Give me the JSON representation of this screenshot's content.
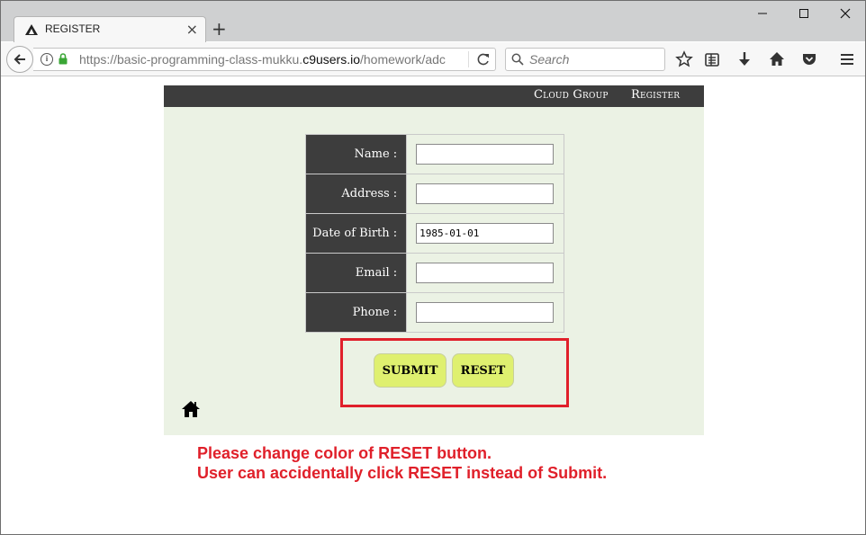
{
  "browser": {
    "tab_title": "REGISTER",
    "tab_close": "×",
    "new_tab": "+",
    "url_prefix": "https://basic-programming-class-mukku.",
    "url_domain": "c9users.io",
    "url_suffix": "/homework/adc",
    "search_placeholder": "Search",
    "window_controls": {
      "minimize": "—",
      "maximize": "☐",
      "close": "✕"
    },
    "icons": [
      "back-icon",
      "info-icon",
      "lock-icon",
      "reload-icon",
      "search-icon",
      "bookmark-star-icon",
      "reader-list-icon",
      "download-icon",
      "home-icon",
      "pocket-icon",
      "menu-icon"
    ]
  },
  "header": {
    "links": [
      "Cloud Group",
      "Register"
    ]
  },
  "form": {
    "fields": [
      {
        "label": "Name :",
        "value": ""
      },
      {
        "label": "Address :",
        "value": ""
      },
      {
        "label": "Date of Birth :",
        "value": "1985-01-01"
      },
      {
        "label": "Email :",
        "value": ""
      },
      {
        "label": "Phone :",
        "value": ""
      }
    ],
    "submit_label": "SUBMIT",
    "reset_label": "RESET"
  },
  "annotation": {
    "line1": "Please change color of RESET button.",
    "line2": "User can accidentally click RESET instead of Submit.",
    "color": "#e0202a"
  },
  "colors": {
    "header_bg": "#3d3d3d",
    "content_bg": "#ebf2e4",
    "button_bg": "#dff06f"
  }
}
